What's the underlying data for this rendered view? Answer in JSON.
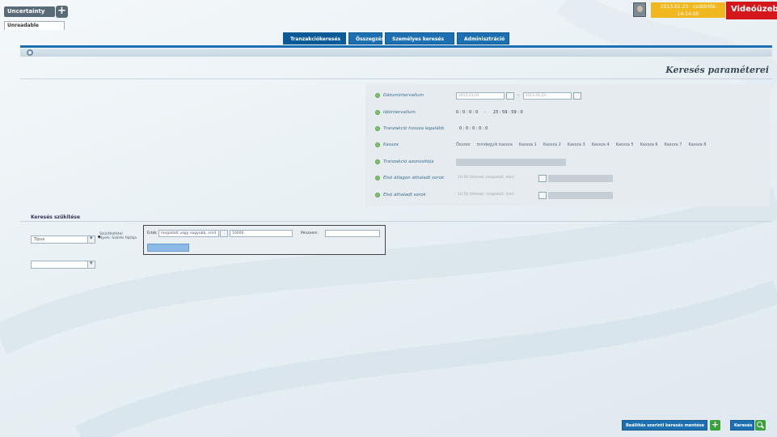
{
  "header": {
    "app_tab_label": "Uncertainty",
    "user_tab_label": "Unreadable",
    "datetime_line1": "2013.01.23 · csütörtök",
    "datetime_line2": "14:14:00",
    "video_label": "Videóüzeb"
  },
  "nav": {
    "tabs": [
      {
        "label": "Tranzakciókeresés",
        "active": true
      },
      {
        "label": "Összegzés",
        "active": false
      },
      {
        "label": "Személyes keresés",
        "active": false
      },
      {
        "label": "Adminisztráció",
        "active": false
      }
    ]
  },
  "page": {
    "title": "Keresés paraméterei"
  },
  "params": {
    "rows": [
      {
        "label": "Dátumintervallum",
        "from": "2013.01.01",
        "sep": "–",
        "to": "2013.01.23"
      },
      {
        "label": "Időintervallum",
        "from": "0 : 0 : 0 : 0",
        "sep": "–",
        "to": "23 : 59 : 59 : 0"
      },
      {
        "label": "Tranzakció hossza legalább",
        "value": "0 : 0 : 0 : 0 : 0"
      },
      {
        "label": "Kassza",
        "options": [
          "Összes",
          "mindegyik kassza",
          "Kassza 1",
          "Kassza 2",
          "Kassza 3",
          "Kassza 4",
          "Kassza 5",
          "Kassza 6",
          "Kassza 7",
          "Kassza 8"
        ]
      },
      {
        "label": "Tranzakció azonosítója",
        "value": ""
      },
      {
        "label": "Első átlagon áthaladt sorok",
        "value": "10-50 (tételek: megadott, min)"
      },
      {
        "label": "Első áthaladt sorok",
        "value": "10-50 (tételek: megadott, min)"
      }
    ]
  },
  "filters": {
    "section_title": "Keresés szűkítése",
    "type_select": "Tipus",
    "radio_label_1": "Szűrőfeltétel",
    "radio_label_2": "Nyelv: Szűrés fajtája",
    "field_label": "Érték",
    "field_value": "megadott vagy nagyobb, mint",
    "amount_value": "10000",
    "currency_label": "Pénznem",
    "currency_value": "",
    "second_select": ""
  },
  "footer": {
    "save_button": "Beállítás szerinti keresés mentése",
    "search_button": "Keresés"
  }
}
